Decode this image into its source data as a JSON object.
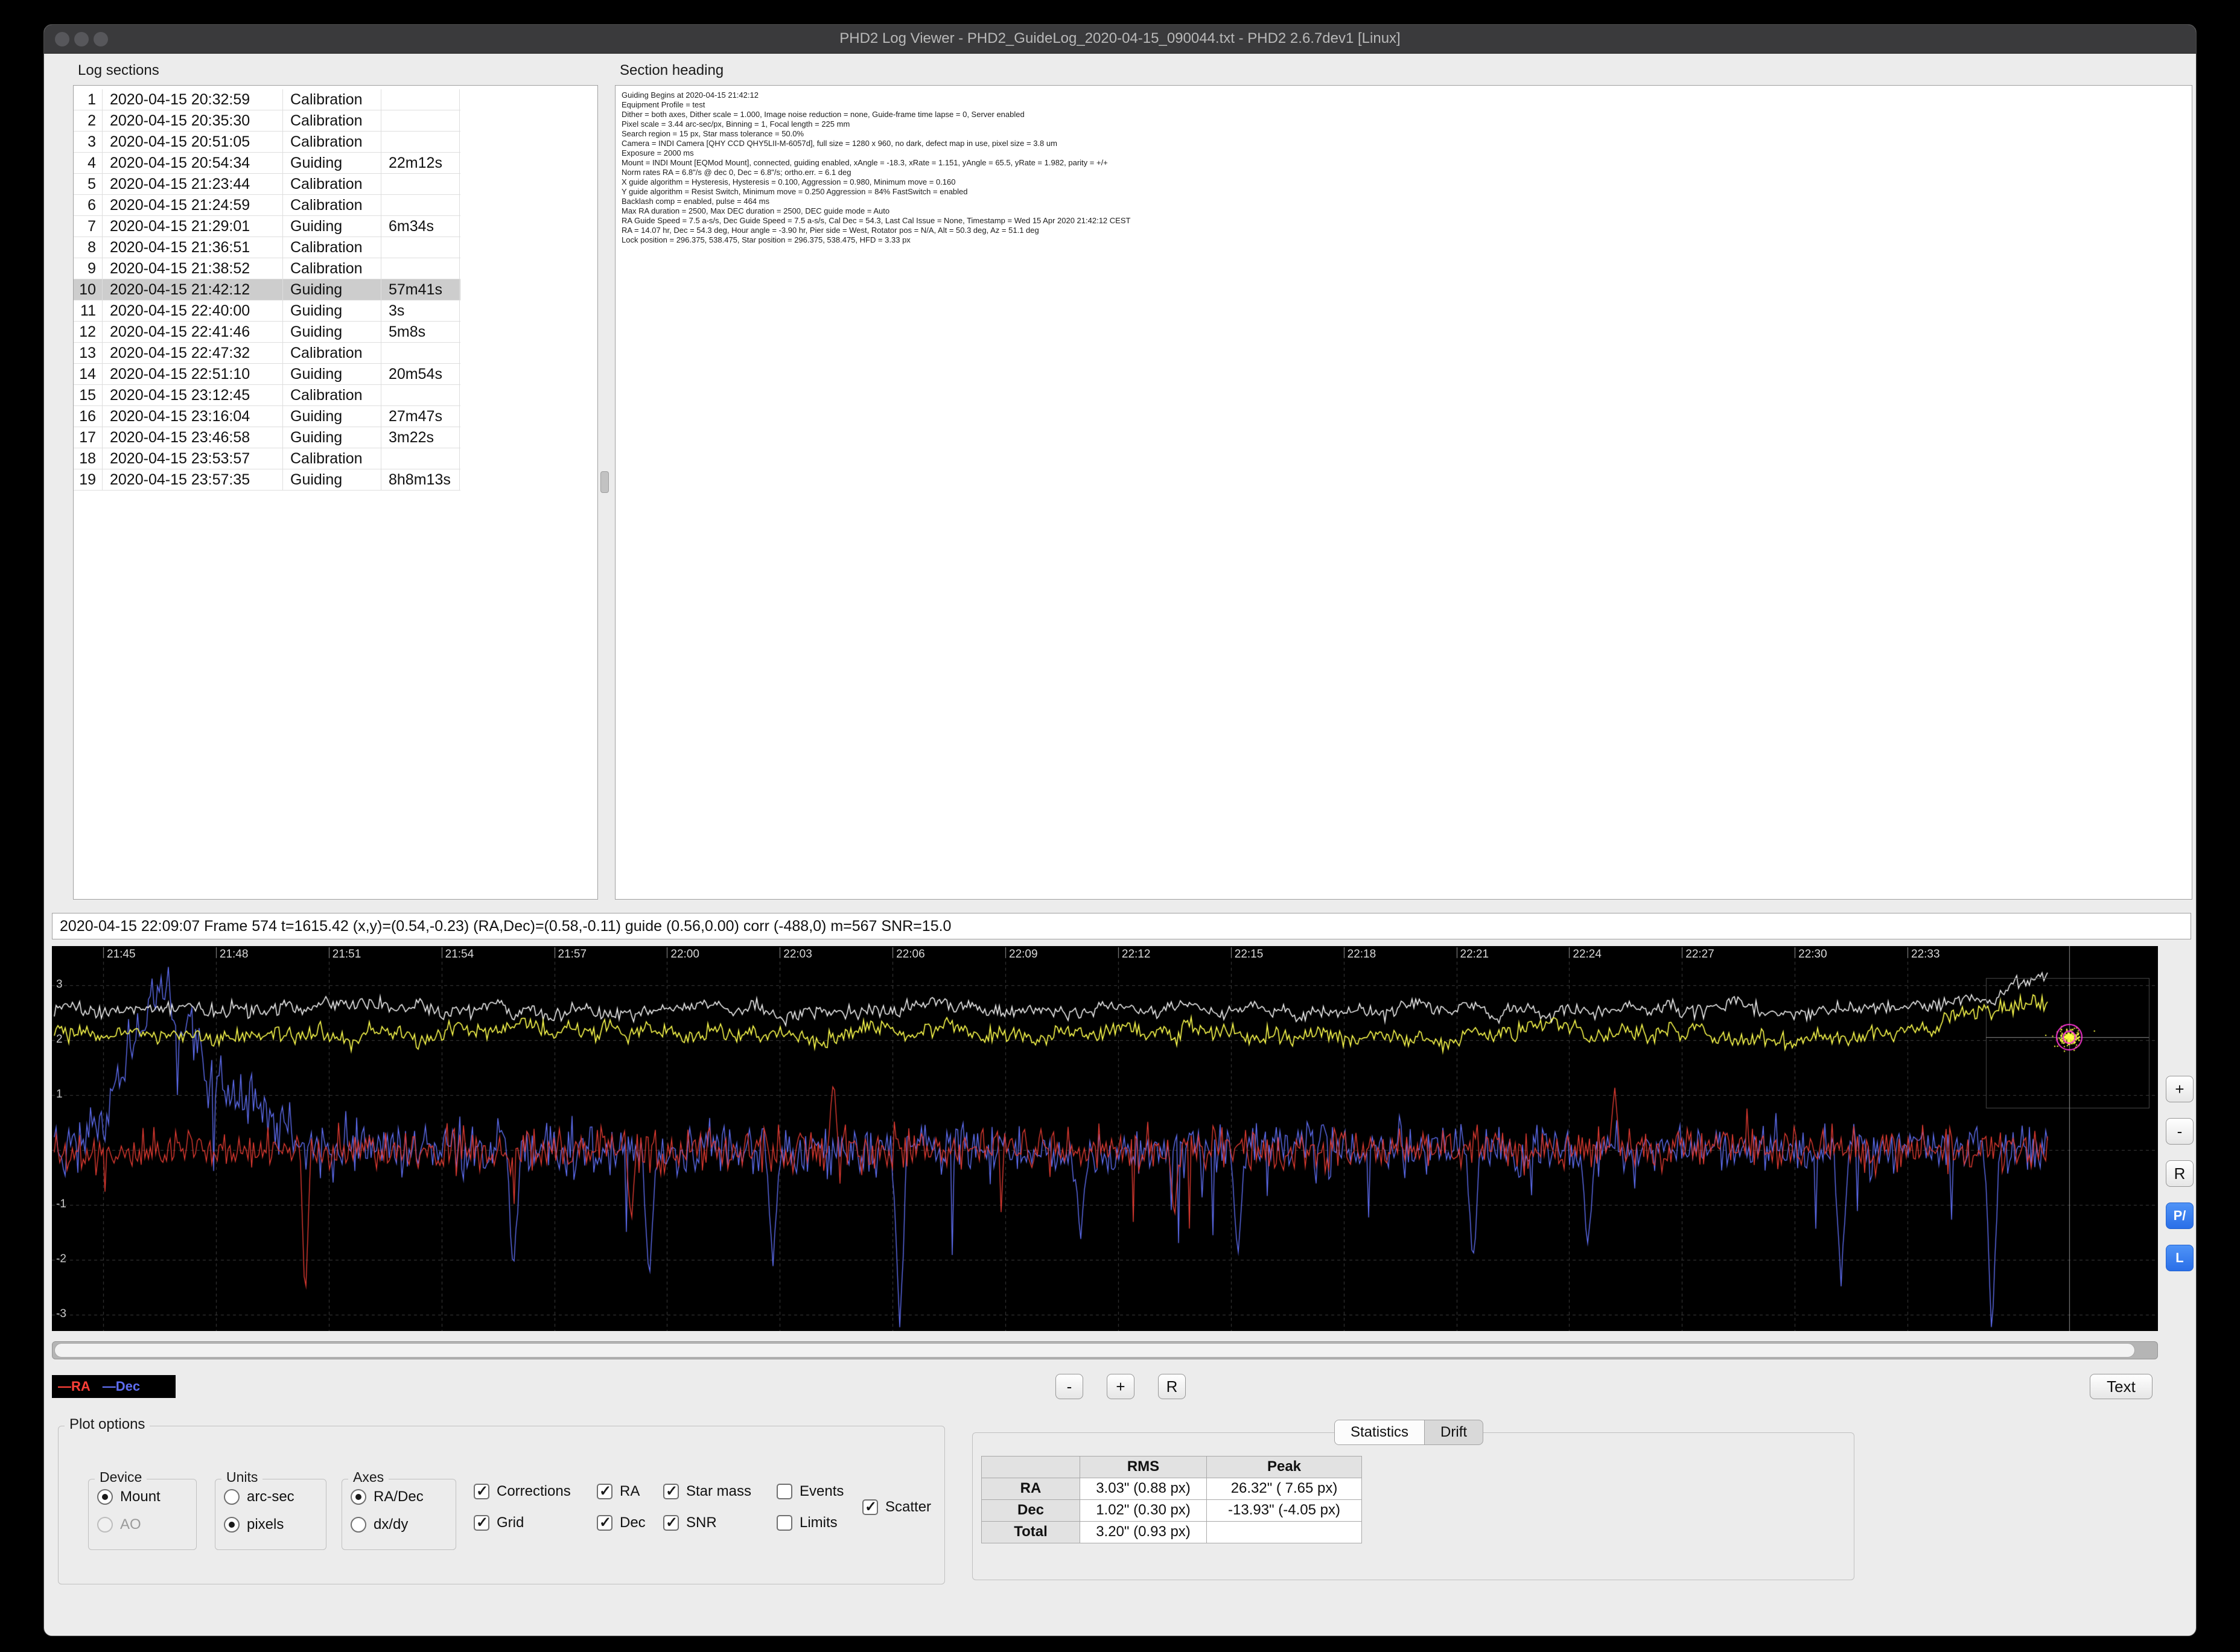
{
  "window": {
    "title": "PHD2 Log Viewer - PHD2_GuideLog_2020-04-15_090044.txt - PHD2 2.6.7dev1 [Linux]"
  },
  "log_sections": {
    "label": "Log sections",
    "selected": "10",
    "rows": [
      [
        "1",
        "2020-04-15 20:32:59",
        "Calibration",
        ""
      ],
      [
        "2",
        "2020-04-15 20:35:30",
        "Calibration",
        ""
      ],
      [
        "3",
        "2020-04-15 20:51:05",
        "Calibration",
        ""
      ],
      [
        "4",
        "2020-04-15 20:54:34",
        "Guiding",
        "22m12s"
      ],
      [
        "5",
        "2020-04-15 21:23:44",
        "Calibration",
        ""
      ],
      [
        "6",
        "2020-04-15 21:24:59",
        "Calibration",
        ""
      ],
      [
        "7",
        "2020-04-15 21:29:01",
        "Guiding",
        "6m34s"
      ],
      [
        "8",
        "2020-04-15 21:36:51",
        "Calibration",
        ""
      ],
      [
        "9",
        "2020-04-15 21:38:52",
        "Calibration",
        ""
      ],
      [
        "10",
        "2020-04-15 21:42:12",
        "Guiding",
        "57m41s"
      ],
      [
        "11",
        "2020-04-15 22:40:00",
        "Guiding",
        "3s"
      ],
      [
        "12",
        "2020-04-15 22:41:46",
        "Guiding",
        "5m8s"
      ],
      [
        "13",
        "2020-04-15 22:47:32",
        "Calibration",
        ""
      ],
      [
        "14",
        "2020-04-15 22:51:10",
        "Guiding",
        "20m54s"
      ],
      [
        "15",
        "2020-04-15 23:12:45",
        "Calibration",
        ""
      ],
      [
        "16",
        "2020-04-15 23:16:04",
        "Guiding",
        "27m47s"
      ],
      [
        "17",
        "2020-04-15 23:46:58",
        "Guiding",
        "3m22s"
      ],
      [
        "18",
        "2020-04-15 23:53:57",
        "Calibration",
        ""
      ],
      [
        "19",
        "2020-04-15 23:57:35",
        "Guiding",
        "8h8m13s"
      ]
    ]
  },
  "section_heading": {
    "label": "Section heading",
    "lines": [
      "Guiding Begins at 2020-04-15 21:42:12",
      "Equipment Profile = test",
      "Dither = both axes, Dither scale = 1.000, Image noise reduction = none, Guide-frame time lapse = 0, Server enabled",
      "Pixel scale = 3.44 arc-sec/px, Binning = 1, Focal length = 225 mm",
      "Search region = 15 px, Star mass tolerance = 50.0%",
      "Camera = INDI Camera [QHY CCD QHY5LII-M-6057d], full size = 1280 x 960, no dark, defect map in use, pixel size = 3.8 um",
      "Exposure = 2000 ms",
      "Mount = INDI Mount [EQMod Mount], connected, guiding enabled, xAngle = -18.3, xRate = 1.151, yAngle = 65.5, yRate = 1.982, parity = +/+",
      "Norm rates RA = 6.8\"/s @ dec 0, Dec = 6.8\"/s; ortho.err. = 6.1 deg",
      "X guide algorithm = Hysteresis, Hysteresis = 0.100, Aggression = 0.980, Minimum move = 0.160",
      "Y guide algorithm = Resist Switch, Minimum move = 0.250 Aggression = 84% FastSwitch = enabled",
      "Backlash comp = enabled, pulse = 464 ms",
      "Max RA duration = 2500, Max DEC duration = 2500, DEC guide mode = Auto",
      "RA Guide Speed = 7.5 a-s/s, Dec Guide Speed = 7.5 a-s/s, Cal Dec = 54.3, Last Cal Issue = None, Timestamp = Wed 15 Apr 2020 21:42:12 CEST",
      "RA = 14.07 hr, Dec = 54.3 deg, Hour angle = -3.90 hr, Pier side = West, Rotator pos = N/A, Alt = 50.3 deg, Az = 51.1 deg",
      "Lock position = 296.375, 538.475, Star position = 296.375, 538.475, HFD = 3.33 px"
    ]
  },
  "frame_info": "2020-04-15 22:09:07 Frame 574 t=1615.42 (x,y)=(0.54,-0.23) (RA,Dec)=(0.58,-0.11) guide (0.56,0.00) corr (-488,0) m=567 SNR=15.0",
  "chart": {
    "time_labels": [
      "21:45",
      "21:48",
      "21:51",
      "21:54",
      "21:57",
      "22:00",
      "22:03",
      "22:06",
      "22:09",
      "22:12",
      "22:15",
      "22:18",
      "22:21",
      "22:24",
      "22:27",
      "22:30",
      "22:33"
    ],
    "y_axis": [
      3,
      2,
      1,
      -1,
      -2,
      -3
    ],
    "grid_y": [
      3,
      2,
      1,
      0,
      -1,
      -2,
      -3
    ],
    "series": [
      {
        "name": "Star mass",
        "color": "#f0f0f0",
        "baseline": 2.55
      },
      {
        "name": "SNR",
        "color": "#ffff4d",
        "baseline": 2.12
      },
      {
        "name": "RA",
        "color": "#e23b32",
        "baseline": 0
      },
      {
        "name": "Dec",
        "color": "#5f6ef2",
        "baseline": 0
      }
    ],
    "legend": [
      {
        "label": "RA",
        "color": "#ff4038"
      },
      {
        "label": "Dec",
        "color": "#5f6ef2"
      }
    ],
    "side_buttons": [
      {
        "label": "+",
        "name": "chart-zoom-in-button",
        "accent": false
      },
      {
        "label": "-",
        "name": "chart-zoom-out-button",
        "accent": false
      },
      {
        "label": "R",
        "name": "chart-reset-button",
        "accent": false
      },
      {
        "label": "P/",
        "name": "chart-pixels-arcsec-toggle",
        "accent": true
      },
      {
        "label": "L",
        "name": "chart-lock-button",
        "accent": true
      }
    ],
    "zoom_buttons": [
      "-",
      "+",
      "R"
    ],
    "text_button": "Text"
  },
  "plot_options": {
    "label": "Plot options",
    "device": {
      "label": "Device",
      "options": [
        {
          "label": "Mount",
          "selected": true,
          "disabled": false
        },
        {
          "label": "AO",
          "selected": false,
          "disabled": true
        }
      ]
    },
    "units": {
      "label": "Units",
      "options": [
        {
          "label": "arc-sec",
          "selected": false,
          "disabled": false
        },
        {
          "label": "pixels",
          "selected": true,
          "disabled": false
        }
      ]
    },
    "axes": {
      "label": "Axes",
      "options": [
        {
          "label": "RA/Dec",
          "selected": true,
          "disabled": false
        },
        {
          "label": "dx/dy",
          "selected": false,
          "disabled": false
        }
      ]
    },
    "checkboxes": [
      {
        "label": "Corrections",
        "checked": true
      },
      {
        "label": "Grid",
        "checked": true
      },
      {
        "label": "RA",
        "checked": true
      },
      {
        "label": "Dec",
        "checked": true
      },
      {
        "label": "Star mass",
        "checked": true
      },
      {
        "label": "SNR",
        "checked": true
      },
      {
        "label": "Events",
        "checked": false
      },
      {
        "label": "Limits",
        "checked": false
      },
      {
        "label": "Scatter",
        "checked": true
      }
    ]
  },
  "statistics": {
    "tabs": [
      "Statistics",
      "Drift"
    ],
    "active": "Statistics",
    "col_headers": [
      "RMS",
      "Peak"
    ],
    "rows": [
      {
        "label": "RA",
        "rms": "3.03\" (0.88 px)",
        "peak": "26.32\" ( 7.65 px)"
      },
      {
        "label": "Dec",
        "rms": "1.02\" (0.30 px)",
        "peak": "-13.93\" (-4.05 px)"
      },
      {
        "label": "Total",
        "rms": "3.20\" (0.93 px)",
        "peak": ""
      }
    ]
  }
}
